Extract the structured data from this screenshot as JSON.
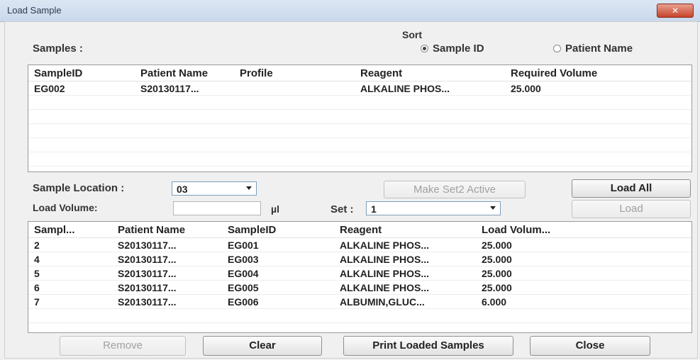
{
  "window": {
    "title": "Load Sample",
    "close_label": "✕"
  },
  "samples_label": "Samples :",
  "sort": {
    "label": "Sort",
    "options": [
      {
        "label": "Sample ID",
        "selected": true
      },
      {
        "label": "Patient Name",
        "selected": false
      }
    ]
  },
  "samples_table": {
    "columns": [
      "SampleID",
      "Patient Name",
      "Profile",
      "Reagent",
      "Required Volume"
    ],
    "rows": [
      [
        "EG002",
        "S20130117...",
        "",
        "ALKALINE PHOS...",
        "25.000"
      ]
    ]
  },
  "sample_location": {
    "label": "Sample Location :",
    "value": "03"
  },
  "make_set2_label": "Make Set2 Active",
  "load_all_label": "Load All",
  "load_volume": {
    "label": "Load Volume:",
    "value": "",
    "unit": "µl"
  },
  "set": {
    "label": "Set :",
    "value": "1"
  },
  "load_label": "Load",
  "loaded_table": {
    "columns": [
      "Sampl...",
      "Patient Name",
      "SampleID",
      "Reagent",
      "Load Volum..."
    ],
    "rows": [
      [
        "2",
        "S20130117...",
        "EG001",
        "ALKALINE PHOS...",
        "25.000"
      ],
      [
        "4",
        "S20130117...",
        "EG003",
        "ALKALINE PHOS...",
        "25.000"
      ],
      [
        "5",
        "S20130117...",
        "EG004",
        "ALKALINE PHOS...",
        "25.000"
      ],
      [
        "6",
        "S20130117...",
        "EG005",
        "ALKALINE PHOS...",
        "25.000"
      ],
      [
        "7",
        "S20130117...",
        "EG006",
        "ALBUMIN,GLUC...",
        "6.000"
      ]
    ]
  },
  "buttons": {
    "remove": "Remove",
    "clear": "Clear",
    "print": "Print Loaded Samples",
    "close": "Close"
  }
}
